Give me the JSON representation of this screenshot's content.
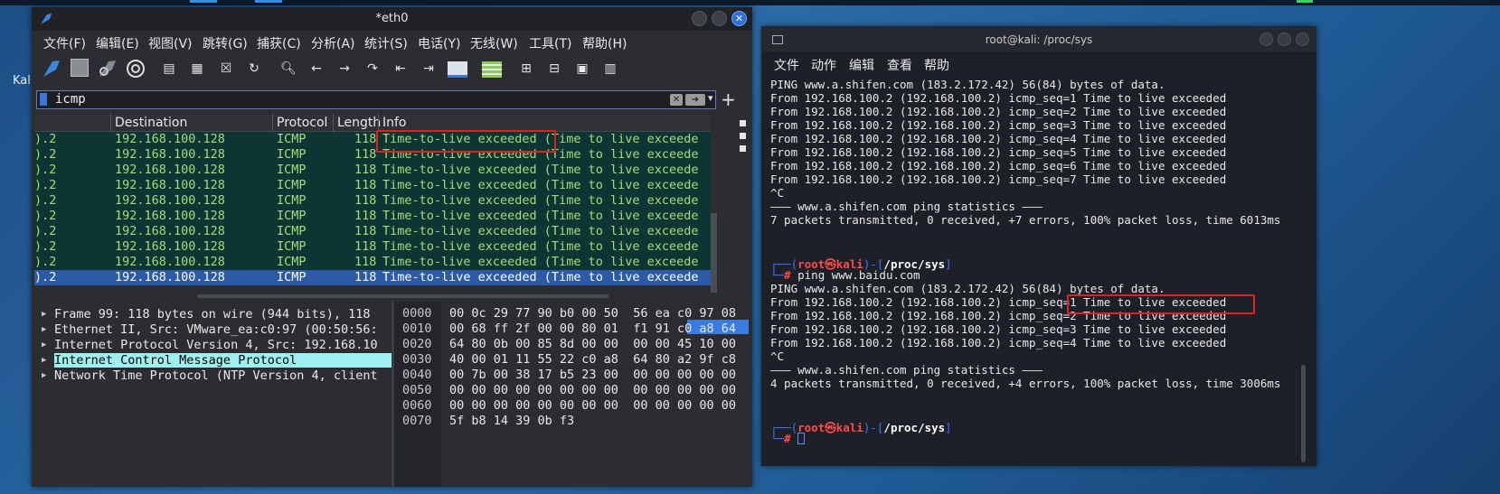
{
  "desktop": {
    "partial_label": "Kal"
  },
  "wireshark": {
    "title": "*eth0",
    "menu": [
      "文件(F)",
      "编辑(E)",
      "视图(V)",
      "跳转(G)",
      "捕获(C)",
      "分析(A)",
      "统计(S)",
      "电话(Y)",
      "无线(W)",
      "工具(T)",
      "帮助(H)"
    ],
    "filter": {
      "value": "icmp"
    },
    "columns": {
      "destination": "Destination",
      "protocol": "Protocol",
      "length": "Length",
      "info": "Info"
    },
    "packets": [
      {
        "src": ").2",
        "dst": "192.168.100.128",
        "proto": "ICMP",
        "len": "118",
        "info": "Time-to-live exceeded (Time to live exceede"
      },
      {
        "src": ").2",
        "dst": "192.168.100.128",
        "proto": "ICMP",
        "len": "118",
        "info": "Time-to-live exceeded (Time to live exceede"
      },
      {
        "src": ").2",
        "dst": "192.168.100.128",
        "proto": "ICMP",
        "len": "118",
        "info": "Time-to-live exceeded (Time to live exceede"
      },
      {
        "src": ").2",
        "dst": "192.168.100.128",
        "proto": "ICMP",
        "len": "118",
        "info": "Time-to-live exceeded (Time to live exceede"
      },
      {
        "src": ").2",
        "dst": "192.168.100.128",
        "proto": "ICMP",
        "len": "118",
        "info": "Time-to-live exceeded (Time to live exceede"
      },
      {
        "src": ").2",
        "dst": "192.168.100.128",
        "proto": "ICMP",
        "len": "118",
        "info": "Time-to-live exceeded (Time to live exceede"
      },
      {
        "src": ").2",
        "dst": "192.168.100.128",
        "proto": "ICMP",
        "len": "118",
        "info": "Time-to-live exceeded (Time to live exceede"
      },
      {
        "src": ").2",
        "dst": "192.168.100.128",
        "proto": "ICMP",
        "len": "118",
        "info": "Time-to-live exceeded (Time to live exceede"
      },
      {
        "src": ").2",
        "dst": "192.168.100.128",
        "proto": "ICMP",
        "len": "118",
        "info": "Time-to-live exceeded (Time to live exceede"
      },
      {
        "src": ").2",
        "dst": "192.168.100.128",
        "proto": "ICMP",
        "len": "118",
        "info": "Time-to-live exceeded (Time to live exceede"
      }
    ],
    "details": [
      "Frame 99: 118 bytes on wire (944 bits), 118",
      "Ethernet II, Src: VMware_ea:c0:97 (00:50:56:",
      "Internet Protocol Version 4, Src: 192.168.10",
      "Internet Control Message Protocol",
      "Network Time Protocol (NTP Version 4, client"
    ],
    "hex": [
      {
        "off": "0000",
        "bytes": "00 0c 29 77 90 b0 00 50  56 ea c0 97 08"
      },
      {
        "off": "0010",
        "bytes": "00 68 ff 2f 00 00 80 01  f1 91 c0 a8 64"
      },
      {
        "off": "0020",
        "bytes": "64 80 0b 00 85 8d 00 00  00 00 45 10 00"
      },
      {
        "off": "0030",
        "bytes": "40 00 01 11 55 22 c0 a8  64 80 a2 9f c8"
      },
      {
        "off": "0040",
        "bytes": "00 7b 00 38 17 b5 23 00  00 00 00 00 00"
      },
      {
        "off": "0050",
        "bytes": "00 00 00 00 00 00 00 00  00 00 00 00 00"
      },
      {
        "off": "0060",
        "bytes": "00 00 00 00 00 00 00 00  00 00 00 00 00"
      },
      {
        "off": "0070",
        "bytes": "5f b8 14 39 0b f3"
      }
    ]
  },
  "terminal": {
    "title": "root@kali: /proc/sys",
    "menu": [
      "文件",
      "动作",
      "编辑",
      "查看",
      "帮助"
    ],
    "lines1": [
      "PING www.a.shifen.com (183.2.172.42) 56(84) bytes of data.",
      "From 192.168.100.2 (192.168.100.2) icmp_seq=1 Time to live exceeded",
      "From 192.168.100.2 (192.168.100.2) icmp_seq=2 Time to live exceeded",
      "From 192.168.100.2 (192.168.100.2) icmp_seq=3 Time to live exceeded",
      "From 192.168.100.2 (192.168.100.2) icmp_seq=4 Time to live exceeded",
      "From 192.168.100.2 (192.168.100.2) icmp_seq=5 Time to live exceeded",
      "From 192.168.100.2 (192.168.100.2) icmp_seq=6 Time to live exceeded",
      "From 192.168.100.2 (192.168.100.2) icmp_seq=7 Time to live exceeded",
      "^C",
      "——— www.a.shifen.com ping statistics ———",
      "7 packets transmitted, 0 received, +7 errors, 100% packet loss, time 6013ms"
    ],
    "prompt": {
      "user": "root",
      "at": "㉿",
      "host": "kali",
      "path": "/proc/sys",
      "symbol": "#"
    },
    "command": "ping www.baidu.com",
    "lines2": [
      "PING www.a.shifen.com (183.2.172.42) 56(84) bytes of data.",
      "From 192.168.100.2 (192.168.100.2) icmp_seq=1 Time to live exceeded",
      "From 192.168.100.2 (192.168.100.2) icmp_seq=2 Time to live exceeded",
      "From 192.168.100.2 (192.168.100.2) icmp_seq=3 Time to live exceeded",
      "From 192.168.100.2 (192.168.100.2) icmp_seq=4 Time to live exceeded",
      "^C",
      "——— www.a.shifen.com ping statistics ———",
      "4 packets transmitted, 0 received, +4 errors, 100% packet loss, time 3006ms"
    ]
  }
}
